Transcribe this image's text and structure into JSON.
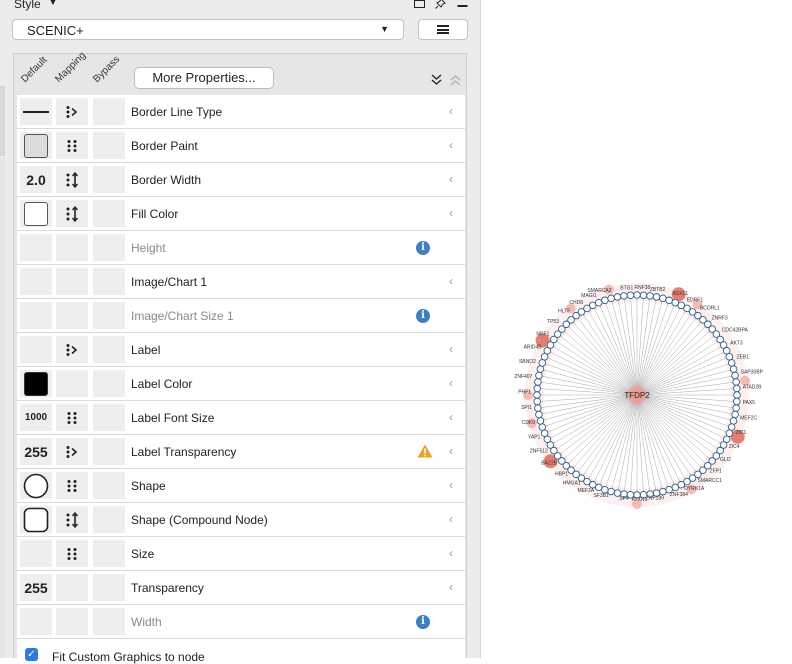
{
  "panel": {
    "title": "Style",
    "style_selector": "SCENIC+",
    "column_headers": [
      "Default",
      "Mapping",
      "Bypass"
    ],
    "more_properties_label": "More Properties..."
  },
  "properties": [
    {
      "label": "Border Line Type",
      "default": "line",
      "mapping": "discrete",
      "enabled": true
    },
    {
      "label": "Border Paint",
      "default": "gray-swatch",
      "mapping": "passthrough",
      "enabled": true
    },
    {
      "label": "Border Width",
      "default": "2.0",
      "mapping": "continuous",
      "enabled": true
    },
    {
      "label": "Fill Color",
      "default": "white-swatch",
      "mapping": "continuous",
      "enabled": true
    },
    {
      "label": "Height",
      "default": "",
      "mapping": "",
      "enabled": false,
      "info": true
    },
    {
      "label": "Image/Chart 1",
      "default": "",
      "mapping": "",
      "enabled": true
    },
    {
      "label": "Image/Chart Size 1",
      "default": "",
      "mapping": "",
      "enabled": false,
      "info": true
    },
    {
      "label": "Label",
      "default": "",
      "mapping": "discrete",
      "enabled": true
    },
    {
      "label": "Label Color",
      "default": "black-swatch",
      "mapping": "",
      "enabled": true
    },
    {
      "label": "Label Font Size",
      "default": "1000",
      "mapping": "passthrough",
      "enabled": true
    },
    {
      "label": "Label Transparency",
      "default": "255",
      "mapping": "discrete",
      "enabled": true,
      "warning": true
    },
    {
      "label": "Shape",
      "default": "circle",
      "mapping": "passthrough",
      "enabled": true
    },
    {
      "label": "Shape (Compound Node)",
      "default": "rounded-rect",
      "mapping": "continuous",
      "enabled": true
    },
    {
      "label": "Size",
      "default": "",
      "mapping": "passthrough",
      "enabled": true
    },
    {
      "label": "Transparency",
      "default": "255",
      "mapping": "",
      "enabled": true
    },
    {
      "label": "Width",
      "default": "",
      "mapping": "",
      "enabled": false,
      "info": true
    }
  ],
  "fit_custom_graphics": {
    "label": "Fit Custom Graphics to node",
    "checked": true
  },
  "network": {
    "hub_label": "TFDP2",
    "node_labels": [
      "RNF38",
      "ZBTB2",
      "ASXL1",
      "EDRF1",
      "BCORL1",
      "ZNRF3",
      "CDC42BPA",
      "AKT3",
      "ZEB1",
      "SAP30BP",
      "ATAD2B",
      "PAX5",
      "MEF2C",
      "ZIC1",
      "ZIC4",
      "GLI2",
      "ZFP1",
      "SMARCC1",
      "DYRK1A",
      "ZNF384",
      "ZNF189",
      "ATXN1",
      "SP4",
      "SF3B1",
      "MEF2A",
      "HMGA1",
      "HBP1",
      "BAZ2B",
      "ZNF512",
      "YAP1",
      "CDK9",
      "SPI1",
      "PHF1",
      "ZNF407",
      "SBNO2",
      "ARID4B",
      "NRF1",
      "TP53",
      "HLTF",
      "CHD8",
      "MAGI1",
      "SMARCA2",
      "BTG1"
    ],
    "colors": {
      "hub": "#f0a090",
      "ring_node": "#ffffff",
      "ring_stroke": "#2d5f8a",
      "edge": "#888888",
      "halo_light": "#fbe4e0",
      "halo_dark": "#e06a5a"
    }
  }
}
